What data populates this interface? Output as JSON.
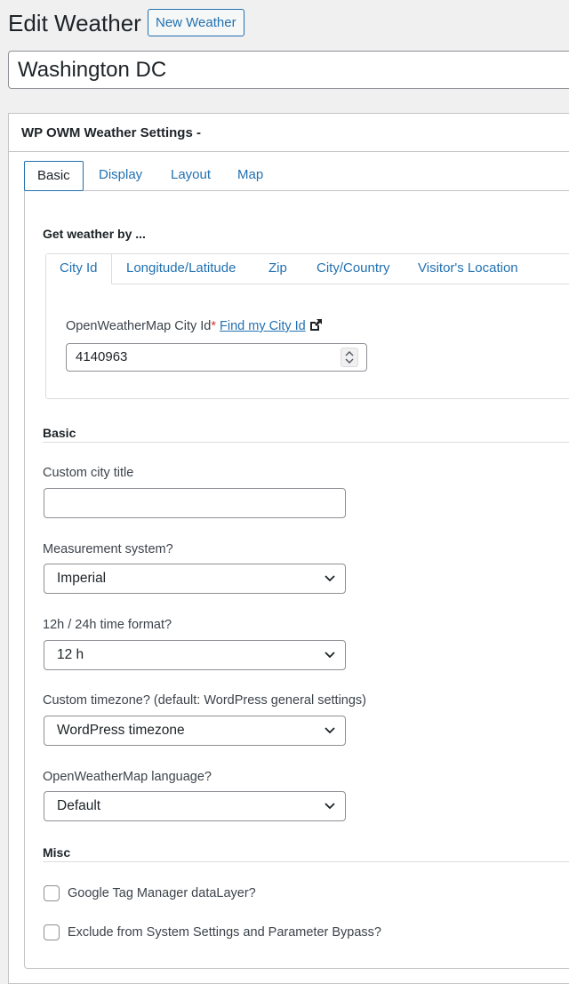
{
  "header": {
    "title": "Edit Weather",
    "new_button": "New Weather",
    "post_title": "Washington DC"
  },
  "panel": {
    "title": "WP OWM Weather Settings -",
    "tabs": [
      "Basic",
      "Display",
      "Layout",
      "Map"
    ],
    "active_tab": "Basic"
  },
  "get_weather": {
    "heading": "Get weather by ...",
    "tabs": [
      "City Id",
      "Longitude/Latitude",
      "Zip",
      "City/Country",
      "Visitor's Location"
    ],
    "active_tab": "City Id",
    "city_id_label": "OpenWeatherMap City Id",
    "required_mark": "*",
    "find_link": "Find my City Id",
    "city_id_value": "4140963"
  },
  "basic": {
    "heading": "Basic",
    "custom_title_label": "Custom city title",
    "custom_title_value": "",
    "measurement_label": "Measurement system?",
    "measurement_value": "Imperial",
    "time_format_label": "12h / 24h time format?",
    "time_format_value": "12 h",
    "timezone_label": "Custom timezone? (default: WordPress general settings)",
    "timezone_value": "WordPress timezone",
    "language_label": "OpenWeatherMap language?",
    "language_value": "Default"
  },
  "misc": {
    "heading": "Misc",
    "gtm_label": "Google Tag Manager dataLayer?",
    "gtm_checked": false,
    "exclude_label": "Exclude from System Settings and Parameter Bypass?",
    "exclude_checked": false
  },
  "colors": {
    "accent": "#2271b1",
    "background": "#f0f0f1",
    "border": "#8c8f94",
    "required": "#d63638"
  }
}
